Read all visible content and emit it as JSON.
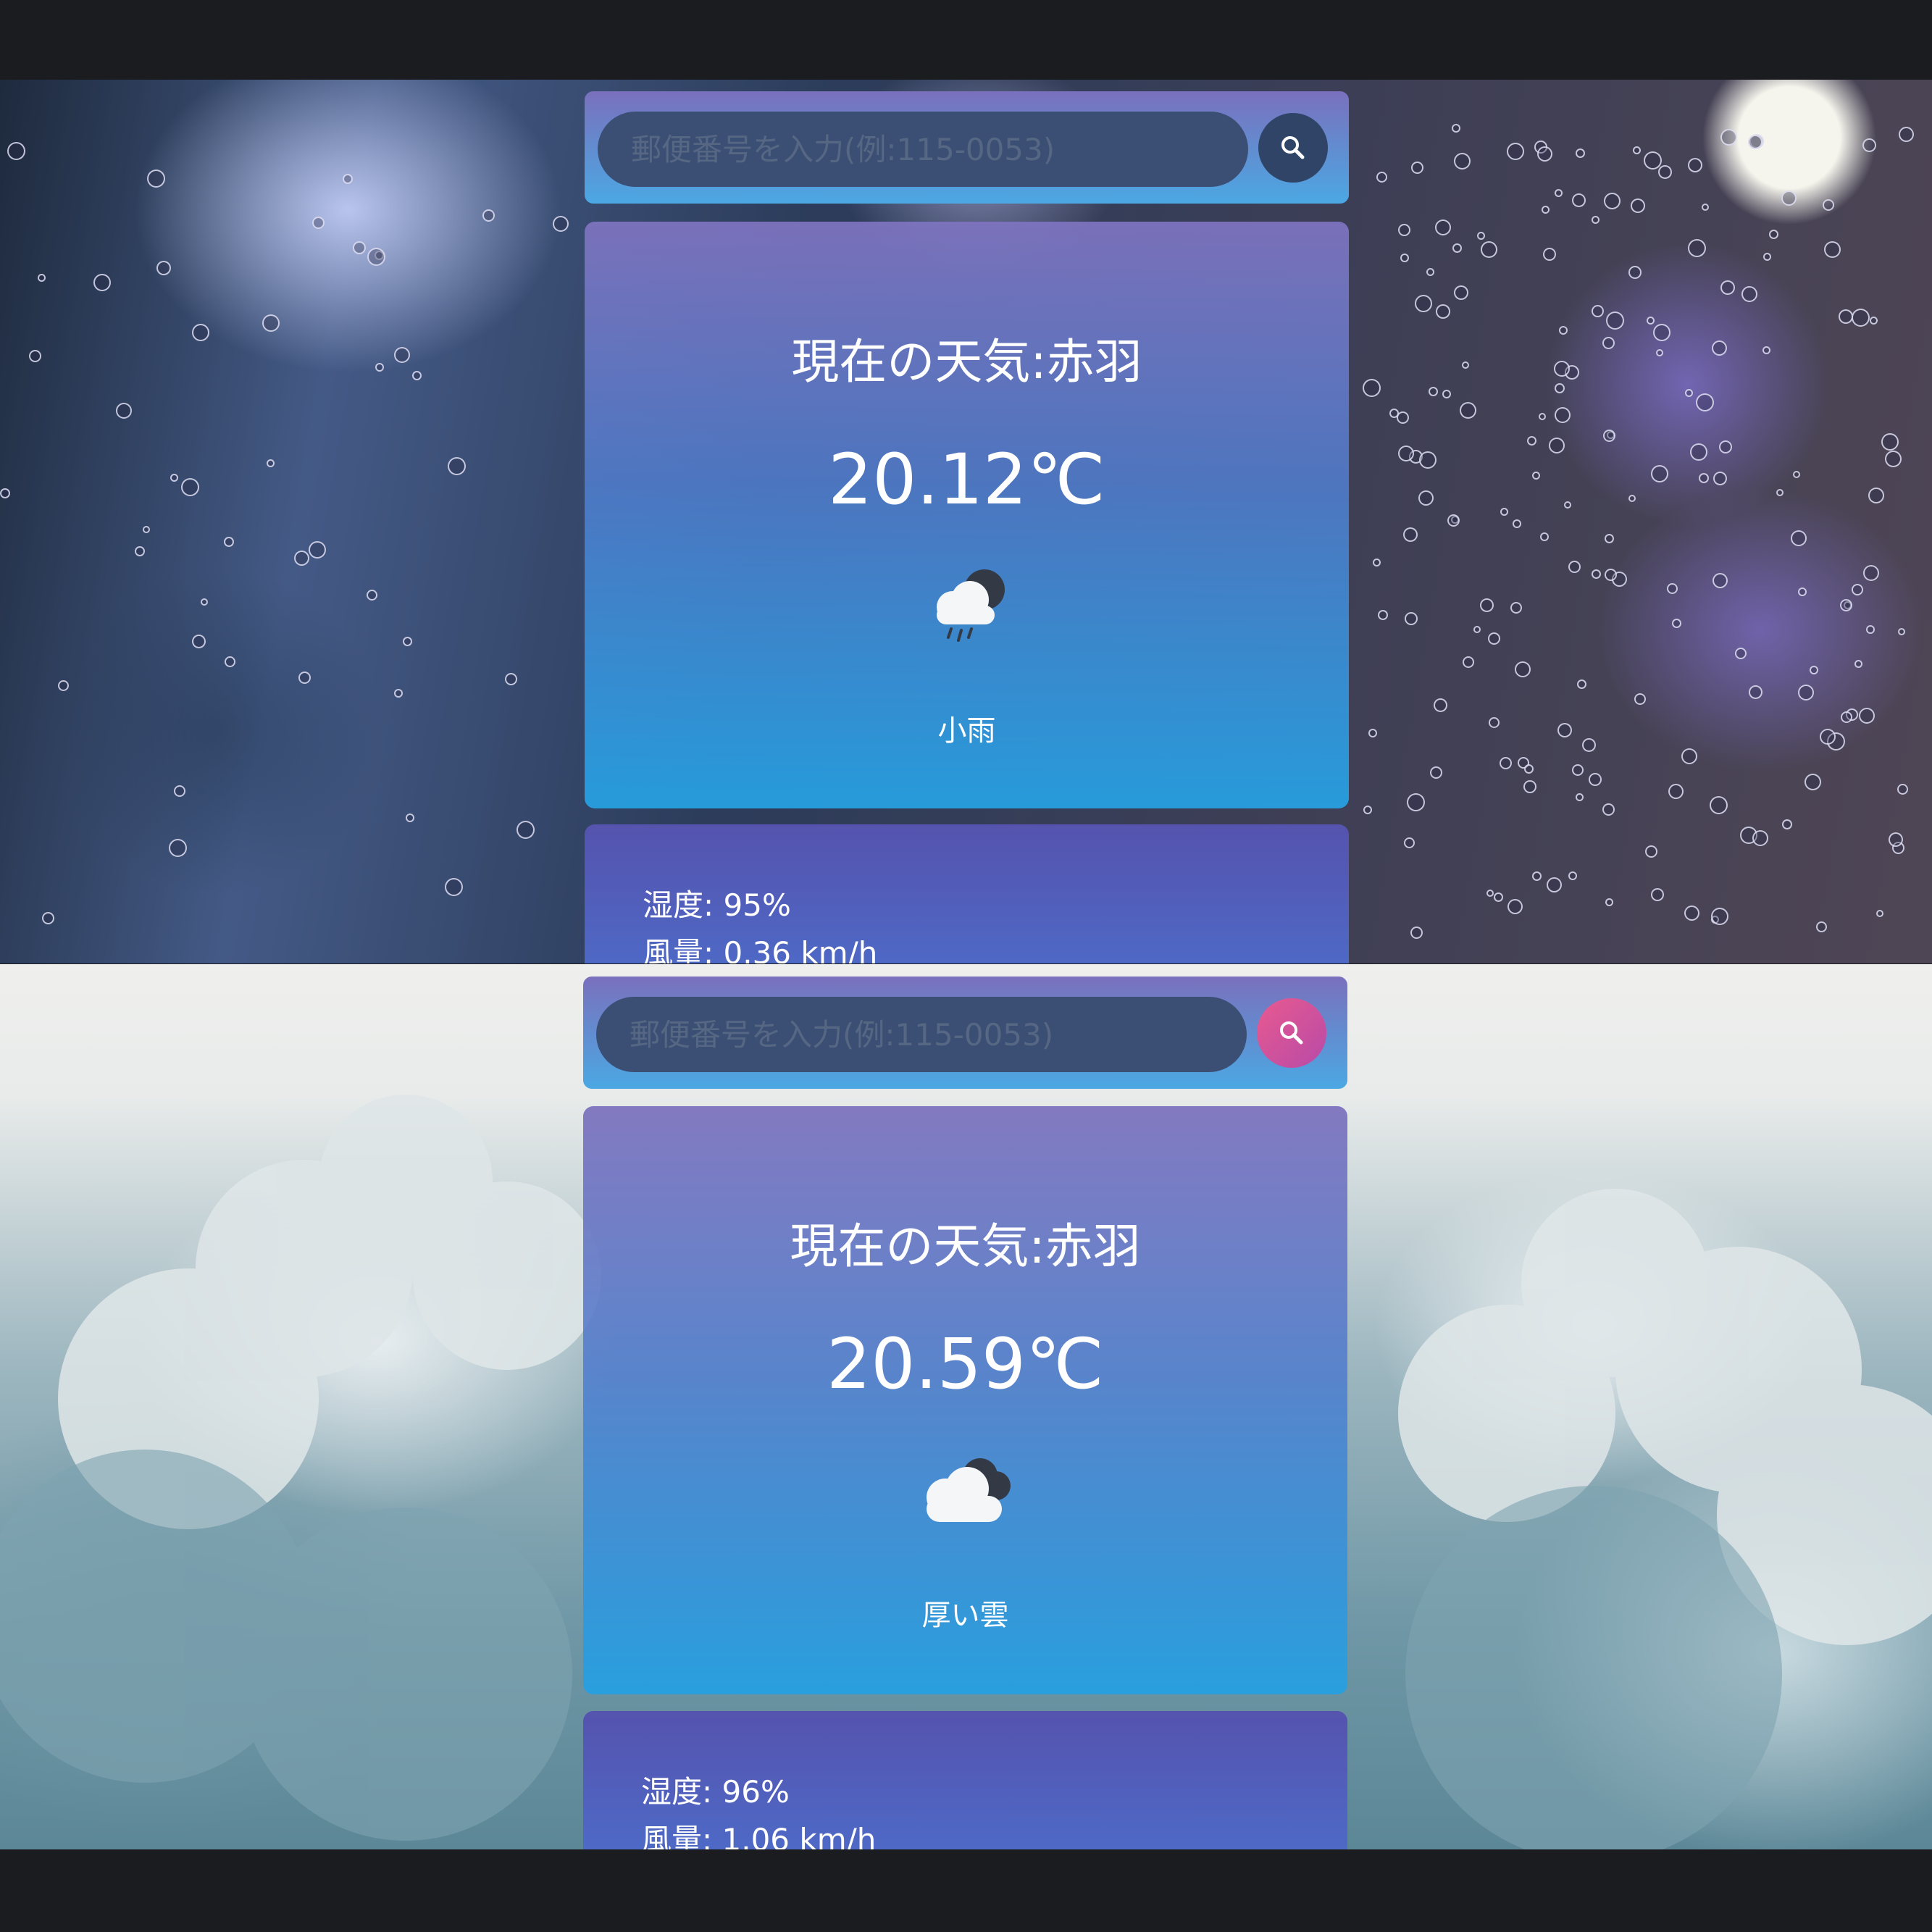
{
  "screens": [
    {
      "search": {
        "placeholder": "郵便番号を入力(例:115-0053)",
        "button_icon": "search-icon",
        "button_color": "#2f4466"
      },
      "weather": {
        "title": "現在の天気:赤羽",
        "temperature": "20.12℃",
        "icon": "light-rain-cloud-icon",
        "description": "小雨"
      },
      "details": {
        "humidity": "湿度: 95%",
        "wind": "風量: 0.36 km/h"
      },
      "background": "rain-window"
    },
    {
      "search": {
        "placeholder": "郵便番号を入力(例:115-0053)",
        "button_icon": "search-icon",
        "button_color": "#d9498f"
      },
      "weather": {
        "title": "現在の天気:赤羽",
        "temperature": "20.59℃",
        "icon": "broken-clouds-icon",
        "description": "厚い雲"
      },
      "details": {
        "humidity": "湿度: 96%",
        "wind": "風量: 1.06 km/h"
      },
      "background": "cumulus-clouds"
    }
  ]
}
